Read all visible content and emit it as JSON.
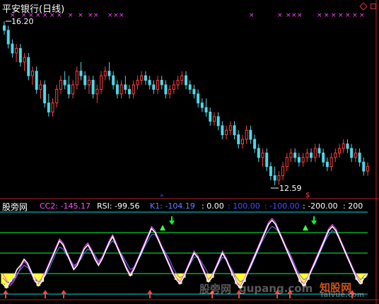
{
  "title": "平安银行(日线)",
  "high_label": "16.20",
  "low_label": "12.59",
  "sub_panel_name": "股旁网",
  "indicators": [
    {
      "text": "CC2: -145.17",
      "color": "#ff4dff"
    },
    {
      "text": "RSI: -99.56",
      "color": "#ffffff"
    },
    {
      "text": "K1: -104.19",
      "color": "#6b7cff"
    },
    {
      "text": ": 0.00",
      "color": "#ffffff"
    },
    {
      "text": ": 100.00",
      "color": "#4a4aff"
    },
    {
      "text": ": -100.00",
      "color": "#4a4aff"
    },
    {
      "text": ": -200.00",
      "color": "#ffffff"
    },
    {
      "text": ": 200",
      "color": "#ffffff"
    }
  ],
  "watermarks": [
    "股旁网",
    "gupang.com",
    "知股网",
    "Talvue.com"
  ],
  "colors": {
    "up": "#ff4040",
    "down": "#4fd7e8",
    "bg": "#000000",
    "white": "#ffffff",
    "magenta": "#ff44ff",
    "blue": "#6b7cff",
    "green": "#00ff40",
    "yellow": "#ffff30",
    "cyan_line": "#00e0e0",
    "panel_border": "#b02020"
  },
  "icons": [
    "up-arrow-icon",
    "down-arrow-icon",
    "triangle-icon",
    "dollar-icon",
    "cross-marker-icon"
  ],
  "chart_data": {
    "type": "candlestick",
    "price_high": 16.2,
    "price_low": 12.59,
    "candles": [
      [
        16.1,
        16.2,
        15.9,
        16.0
      ],
      [
        16.0,
        16.1,
        15.6,
        15.7
      ],
      [
        15.7,
        15.8,
        15.4,
        15.5
      ],
      [
        15.5,
        15.7,
        15.3,
        15.6
      ],
      [
        15.6,
        15.7,
        15.2,
        15.3
      ],
      [
        15.3,
        15.5,
        15.1,
        15.4
      ],
      [
        15.4,
        15.5,
        14.9,
        15.0
      ],
      [
        15.0,
        15.2,
        14.8,
        15.1
      ],
      [
        15.1,
        15.2,
        14.6,
        14.7
      ],
      [
        14.7,
        14.9,
        14.5,
        14.8
      ],
      [
        14.8,
        14.9,
        14.3,
        14.4
      ],
      [
        14.4,
        14.6,
        14.1,
        14.2
      ],
      [
        14.2,
        14.5,
        14.1,
        14.4
      ],
      [
        14.4,
        14.8,
        14.3,
        14.7
      ],
      [
        14.7,
        15.0,
        14.6,
        14.9
      ],
      [
        14.9,
        15.1,
        14.7,
        14.8
      ],
      [
        14.8,
        15.0,
        14.5,
        14.6
      ],
      [
        14.6,
        14.9,
        14.5,
        14.8
      ],
      [
        14.8,
        15.2,
        14.7,
        15.1
      ],
      [
        15.1,
        15.3,
        14.9,
        15.0
      ],
      [
        15.0,
        15.1,
        14.7,
        14.8
      ],
      [
        14.8,
        15.0,
        14.6,
        14.9
      ],
      [
        14.9,
        15.0,
        14.5,
        14.6
      ],
      [
        14.6,
        14.8,
        14.4,
        14.7
      ],
      [
        14.7,
        15.1,
        14.6,
        15.0
      ],
      [
        15.0,
        15.2,
        14.9,
        15.1
      ],
      [
        15.1,
        15.3,
        14.9,
        15.0
      ],
      [
        15.0,
        15.1,
        14.7,
        14.8
      ],
      [
        14.8,
        14.9,
        14.5,
        14.6
      ],
      [
        14.6,
        14.9,
        14.5,
        14.8
      ],
      [
        14.8,
        15.0,
        14.6,
        14.7
      ],
      [
        14.7,
        14.8,
        14.5,
        14.6
      ],
      [
        14.6,
        14.9,
        14.5,
        14.8
      ],
      [
        14.8,
        15.0,
        14.7,
        14.9
      ],
      [
        14.9,
        15.1,
        14.8,
        15.0
      ],
      [
        15.0,
        15.1,
        14.8,
        14.9
      ],
      [
        14.9,
        15.0,
        14.7,
        14.8
      ],
      [
        14.8,
        14.9,
        14.6,
        14.7
      ],
      [
        14.7,
        15.0,
        14.6,
        14.9
      ],
      [
        14.9,
        15.0,
        14.7,
        14.8
      ],
      [
        14.8,
        14.9,
        14.5,
        14.6
      ],
      [
        14.6,
        14.8,
        14.5,
        14.7
      ],
      [
        14.7,
        14.9,
        14.6,
        14.8
      ],
      [
        14.8,
        15.0,
        14.7,
        14.9
      ],
      [
        14.9,
        15.1,
        14.8,
        15.0
      ],
      [
        15.0,
        15.1,
        14.7,
        14.8
      ],
      [
        14.8,
        14.9,
        14.6,
        14.7
      ],
      [
        14.7,
        14.8,
        14.5,
        14.6
      ],
      [
        14.6,
        14.7,
        14.3,
        14.4
      ],
      [
        14.4,
        14.5,
        14.2,
        14.3
      ],
      [
        14.3,
        14.5,
        14.1,
        14.2
      ],
      [
        14.2,
        14.3,
        13.9,
        14.0
      ],
      [
        14.0,
        14.2,
        13.9,
        14.1
      ],
      [
        14.1,
        14.2,
        13.8,
        13.9
      ],
      [
        13.9,
        14.0,
        13.6,
        13.7
      ],
      [
        13.7,
        13.9,
        13.6,
        13.8
      ],
      [
        13.8,
        14.0,
        13.7,
        13.9
      ],
      [
        13.9,
        14.0,
        13.6,
        13.7
      ],
      [
        13.7,
        13.8,
        13.4,
        13.5
      ],
      [
        13.5,
        13.7,
        13.4,
        13.6
      ],
      [
        13.6,
        13.9,
        13.5,
        13.8
      ],
      [
        13.8,
        13.9,
        13.5,
        13.6
      ],
      [
        13.6,
        13.7,
        13.3,
        13.4
      ],
      [
        13.4,
        13.5,
        13.1,
        13.2
      ],
      [
        13.2,
        13.4,
        13.0,
        13.3
      ],
      [
        13.3,
        13.4,
        12.9,
        13.0
      ],
      [
        13.0,
        13.1,
        12.7,
        12.8
      ],
      [
        12.8,
        13.0,
        12.59,
        12.7
      ],
      [
        12.7,
        12.9,
        12.6,
        12.8
      ],
      [
        12.8,
        13.1,
        12.7,
        13.0
      ],
      [
        13.0,
        13.3,
        12.9,
        13.2
      ],
      [
        13.2,
        13.4,
        13.1,
        13.3
      ],
      [
        13.3,
        13.4,
        13.1,
        13.2
      ],
      [
        13.2,
        13.3,
        13.0,
        13.1
      ],
      [
        13.1,
        13.3,
        13.0,
        13.2
      ],
      [
        13.2,
        13.4,
        13.1,
        13.3
      ],
      [
        13.3,
        13.4,
        13.1,
        13.2
      ],
      [
        13.2,
        13.5,
        13.1,
        13.4
      ],
      [
        13.4,
        13.5,
        13.2,
        13.3
      ],
      [
        13.3,
        13.4,
        13.0,
        13.1
      ],
      [
        13.1,
        13.2,
        12.9,
        13.0
      ],
      [
        13.0,
        13.3,
        12.9,
        13.2
      ],
      [
        13.2,
        13.4,
        13.1,
        13.3
      ],
      [
        13.3,
        13.5,
        13.2,
        13.4
      ],
      [
        13.4,
        13.6,
        13.3,
        13.5
      ],
      [
        13.5,
        13.6,
        13.3,
        13.4
      ],
      [
        13.4,
        13.5,
        13.1,
        13.2
      ],
      [
        13.2,
        13.4,
        13.1,
        13.3
      ],
      [
        13.3,
        13.4,
        13.0,
        13.1
      ],
      [
        13.1,
        13.2,
        12.8,
        12.9
      ],
      [
        12.9,
        13.1,
        12.8,
        13.0
      ]
    ],
    "oscillator": {
      "range": [
        -200,
        200
      ],
      "rsi": [
        -150,
        -170,
        -140,
        -120,
        -80,
        -60,
        -30,
        -50,
        -90,
        -130,
        -160,
        -140,
        -100,
        -60,
        -20,
        20,
        60,
        40,
        0,
        -40,
        -80,
        -60,
        -20,
        20,
        40,
        10,
        -30,
        -60,
        -30,
        10,
        50,
        80,
        40,
        0,
        -40,
        -80,
        -110,
        -80,
        -40,
        0,
        40,
        80,
        120,
        100,
        60,
        20,
        -20,
        -60,
        -100,
        -130,
        -150,
        -120,
        -80,
        -40,
        0,
        -20,
        -60,
        -100,
        -140,
        -120,
        -80,
        -40,
        0,
        -30,
        -70,
        -110,
        -150,
        -170,
        -140,
        -100,
        -60,
        -20,
        20,
        60,
        100,
        140,
        160,
        140,
        100,
        60,
        20,
        -20,
        -60,
        -100,
        -140,
        -160,
        -130,
        -90,
        -50,
        -10,
        30,
        70,
        110,
        130,
        110,
        70,
        30,
        -10,
        -50,
        -90,
        -130,
        -150,
        -120,
        -100
      ],
      "k1": [
        -120,
        -140,
        -150,
        -130,
        -100,
        -80,
        -60,
        -70,
        -100,
        -120,
        -140,
        -130,
        -110,
        -80,
        -40,
        0,
        30,
        20,
        -10,
        -30,
        -60,
        -50,
        -30,
        0,
        20,
        10,
        -10,
        -40,
        -20,
        10,
        40,
        60,
        40,
        10,
        -20,
        -50,
        -80,
        -70,
        -40,
        -10,
        30,
        60,
        90,
        90,
        60,
        30,
        0,
        -30,
        -70,
        -100,
        -120,
        -110,
        -80,
        -50,
        -20,
        -20,
        -40,
        -70,
        -100,
        -100,
        -80,
        -50,
        -20,
        -30,
        -60,
        -90,
        -120,
        -140,
        -130,
        -100,
        -70,
        -30,
        10,
        50,
        80,
        110,
        130,
        120,
        100,
        70,
        30,
        0,
        -40,
        -80,
        -110,
        -130,
        -120,
        -90,
        -60,
        -20,
        20,
        60,
        90,
        110,
        100,
        70,
        40,
        0,
        -40,
        -80,
        -110,
        -130,
        -110,
        -100
      ],
      "cc2": [
        -100,
        -130,
        -160,
        -140,
        -110,
        -70,
        -40,
        -60,
        -100,
        -140,
        -150,
        -120,
        -90,
        -50,
        -10,
        30,
        70,
        50,
        10,
        -30,
        -70,
        -50,
        -10,
        30,
        50,
        20,
        -20,
        -50,
        -20,
        20,
        60,
        90,
        50,
        10,
        -30,
        -70,
        -100,
        -70,
        -30,
        10,
        50,
        90,
        130,
        110,
        70,
        30,
        -10,
        -50,
        -90,
        -120,
        -140,
        -110,
        -70,
        -30,
        10,
        -10,
        -50,
        -90,
        -130,
        -110,
        -70,
        -30,
        10,
        -20,
        -60,
        -100,
        -140,
        -160,
        -130,
        -90,
        -50,
        -10,
        30,
        70,
        110,
        150,
        170,
        150,
        110,
        70,
        30,
        -10,
        -50,
        -90,
        -130,
        -150,
        -120,
        -80,
        -40,
        0,
        40,
        80,
        120,
        140,
        120,
        80,
        40,
        0,
        -40,
        -80,
        -120,
        -145,
        -120,
        -110
      ]
    }
  }
}
